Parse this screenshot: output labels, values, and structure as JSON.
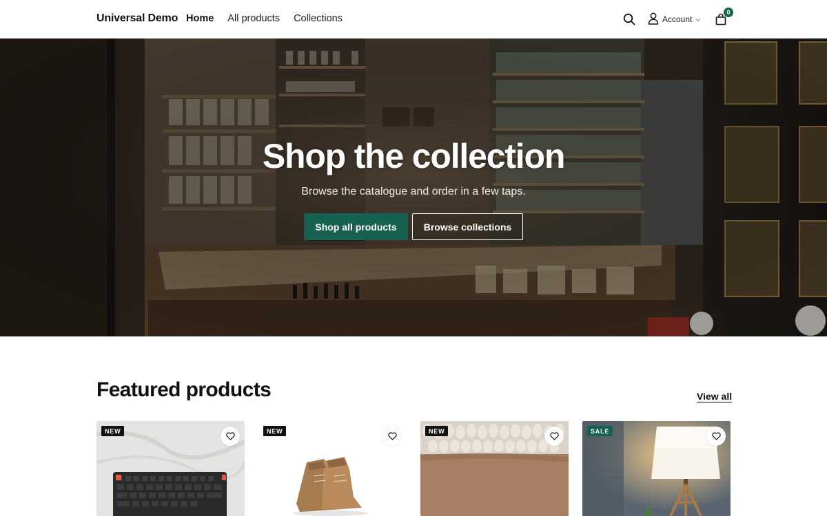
{
  "header": {
    "brand": "Universal Demo",
    "nav": [
      {
        "label": "Home",
        "active": true
      },
      {
        "label": "All products",
        "active": false
      },
      {
        "label": "Collections",
        "active": false
      }
    ],
    "account_label": "Account",
    "cart_count": "0",
    "icons": {
      "search": "search-icon",
      "account": "user-icon",
      "cart": "shopping-bag-icon",
      "dropdown": "chevron-down-icon"
    }
  },
  "hero": {
    "title": "Shop the collection",
    "subtitle": "Browse the catalogue and order in a few taps.",
    "primary_button": "Shop all products",
    "secondary_button": "Browse collections"
  },
  "featured": {
    "title": "Featured products",
    "view_all": "View all",
    "products": [
      {
        "badge": "NEW",
        "image": "keyboard"
      },
      {
        "badge": "NEW",
        "image": "boots"
      },
      {
        "badge": "NEW",
        "image": "knit-fabric"
      },
      {
        "badge": "SALE",
        "image": "lamp"
      }
    ]
  },
  "colors": {
    "accent": "#16614f",
    "text": "#111111",
    "badge_new": "#111111",
    "badge_sale": "#16614f"
  }
}
